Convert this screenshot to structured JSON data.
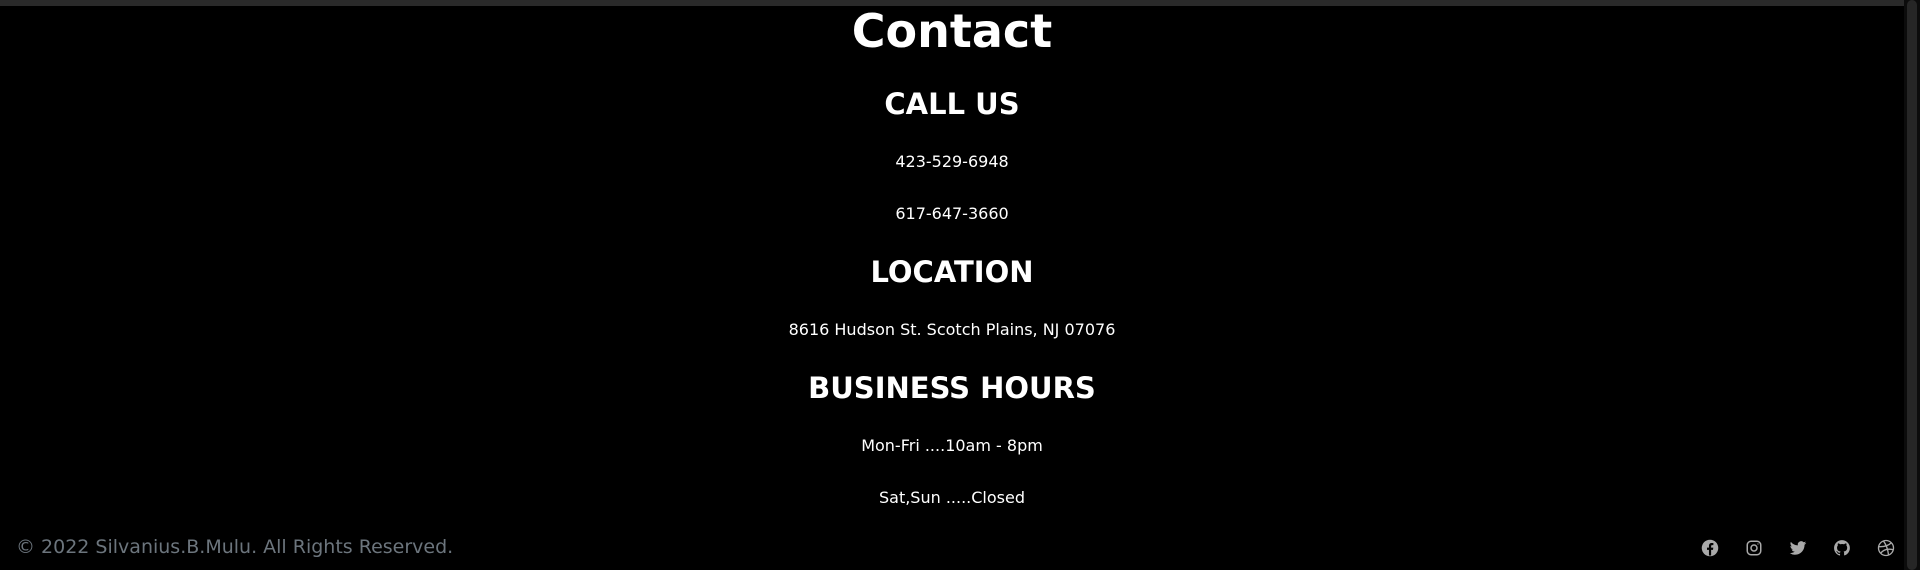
{
  "page": {
    "title": "Contact"
  },
  "sections": {
    "call": {
      "heading": "CALL US",
      "phones": [
        "423-529-6948",
        "617-647-3660"
      ]
    },
    "location": {
      "heading": "LOCATION",
      "address": "8616 Hudson St. Scotch Plains, NJ 07076"
    },
    "hours": {
      "heading": "BUSINESS HOURS",
      "lines": [
        "Mon-Fri ....10am - 8pm",
        "Sat,Sun .....Closed"
      ]
    }
  },
  "footer": {
    "copyright": "© 2022 Silvanius.B.Mulu. All Rights Reserved.",
    "social_icons": [
      "facebook-icon",
      "instagram-icon",
      "twitter-icon",
      "github-icon",
      "dribbble-icon"
    ]
  },
  "colors": {
    "background": "#000000",
    "text": "#ffffff",
    "muted": "#6c757d",
    "icon": "#a9a9a9"
  }
}
